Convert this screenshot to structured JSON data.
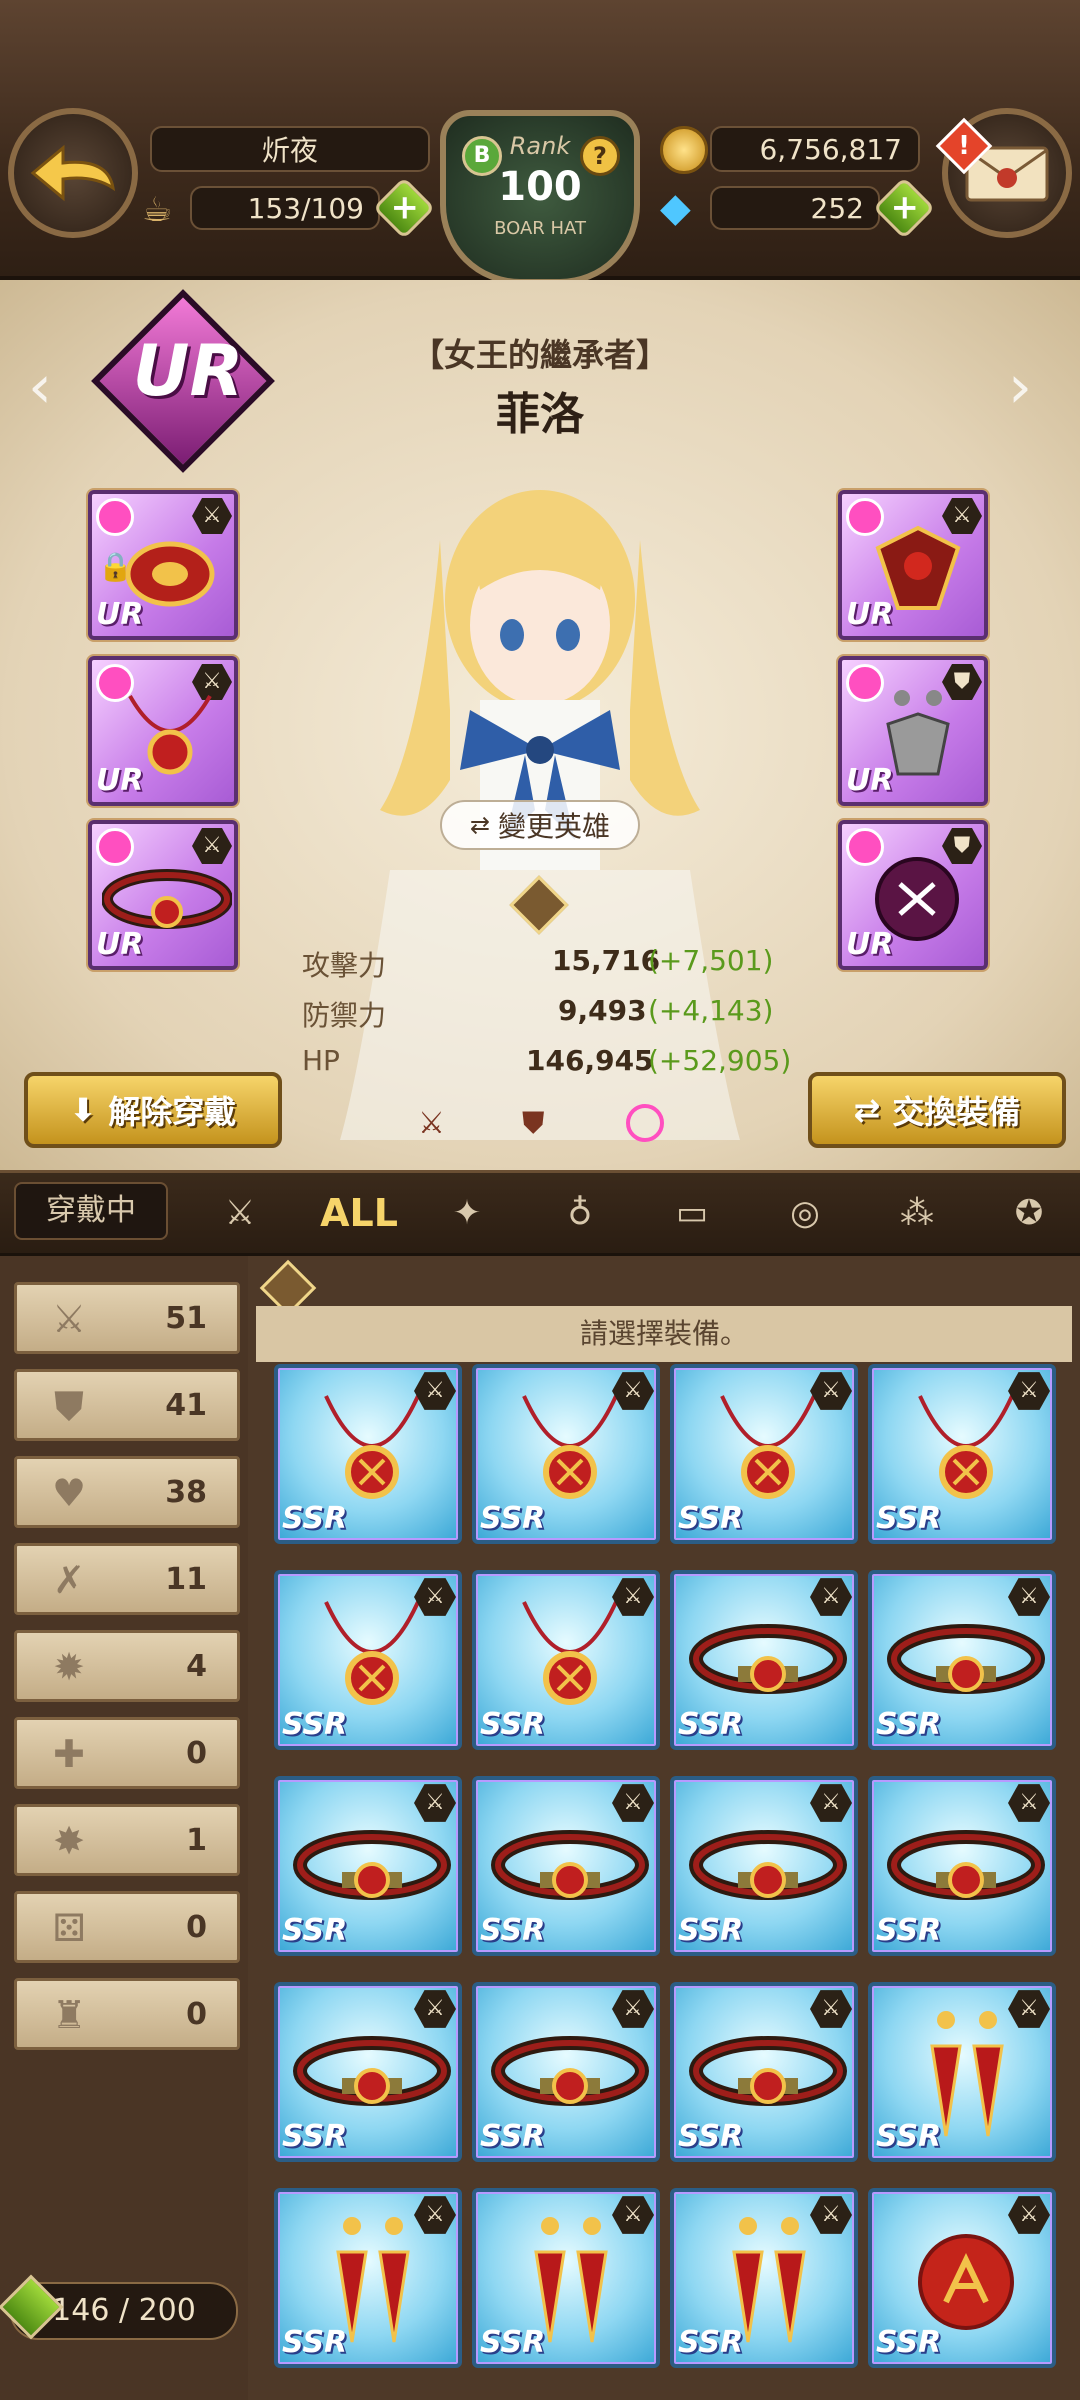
{
  "header": {
    "player_name": "炘夜",
    "stamina": "153/109",
    "rank_label": "Rank",
    "rank_value": "100",
    "rank_subtitle": "BOAR HAT",
    "gold": "6,756,817",
    "gems": "252",
    "mail_alert": "!",
    "plus": "+"
  },
  "hero": {
    "rarity": "UR",
    "title": "【女王的繼承者】",
    "name": "菲洛",
    "change_hero_label": "變更英雄",
    "stats": [
      {
        "label": "攻擊力",
        "value": "15,716",
        "bonus": "(+7,501)"
      },
      {
        "label": "防禦力",
        "value": "9,493",
        "bonus": "(+4,143)"
      },
      {
        "label": "HP",
        "value": "146,945",
        "bonus": "(+52,905)"
      }
    ],
    "unequip_label": "解除穿戴",
    "swap_label": "交換裝備",
    "slot_rarity": "UR"
  },
  "tabs": {
    "equipped_label": "穿戴中",
    "all_label": "ALL"
  },
  "counts": [
    {
      "icon": "attack-icon",
      "glyph": "⚔",
      "value": "51"
    },
    {
      "icon": "defense-icon",
      "glyph": "⛊",
      "value": "41"
    },
    {
      "icon": "hp-heart-icon",
      "glyph": "♥",
      "value": "38"
    },
    {
      "icon": "crit-icon",
      "glyph": "✗",
      "value": "11"
    },
    {
      "icon": "burst-icon",
      "glyph": "✹",
      "value": "4"
    },
    {
      "icon": "recovery-cross-icon",
      "glyph": "✚",
      "value": "0"
    },
    {
      "icon": "star-burst-icon",
      "glyph": "✸",
      "value": "1"
    },
    {
      "icon": "dice-icon",
      "glyph": "⚄",
      "value": "0"
    },
    {
      "icon": "fang-icon",
      "glyph": "♜",
      "value": "0"
    }
  ],
  "grid": {
    "prompt": "請選擇裝備。",
    "item_rarity": "SSR",
    "items": [
      "necklace",
      "necklace",
      "necklace",
      "necklace",
      "necklace",
      "necklace",
      "belt",
      "belt",
      "belt",
      "belt",
      "belt",
      "belt",
      "belt",
      "belt",
      "belt",
      "earrings",
      "earrings",
      "earrings",
      "earrings",
      "ring"
    ]
  },
  "capacity": "146 / 200",
  "colors": {
    "accent_gold": "#f6d46a",
    "stat_bonus": "#5a9a1c",
    "ur_pink": "#c67be8",
    "ssr_blue": "#3aa7d6"
  }
}
